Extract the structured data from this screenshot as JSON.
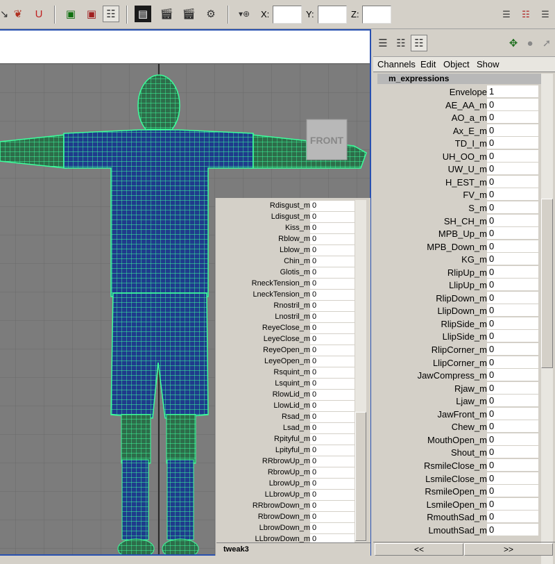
{
  "toolbar": {
    "icons": [
      "snap-arrow-icon",
      "snap-curve-icon",
      "snap-magnet-icon",
      "render-region-icon",
      "render-camera-icon",
      "render-settings-icon",
      "clapper-icon",
      "clapper-ipr-icon",
      "clapper-hw-icon",
      "clapper-settings-icon",
      "select-marker-icon"
    ],
    "x_label": "X:",
    "y_label": "Y:",
    "z_label": "Z:",
    "x_value": "",
    "y_value": "",
    "z_value": ""
  },
  "viewport": {
    "view_cube_label": "FRONT",
    "mesh_color": "#3cff9c",
    "background_color": "#7c7c7c"
  },
  "tweak_panel": {
    "node": "tweak3",
    "channels": [
      {
        "name": "Rdisgust_m",
        "value": "0"
      },
      {
        "name": "Ldisgust_m",
        "value": "0"
      },
      {
        "name": "Kiss_m",
        "value": "0"
      },
      {
        "name": "Rblow_m",
        "value": "0"
      },
      {
        "name": "Lblow_m",
        "value": "0"
      },
      {
        "name": "Chin_m",
        "value": "0"
      },
      {
        "name": "Glotis_m",
        "value": "0"
      },
      {
        "name": "RneckTension_m",
        "value": "0"
      },
      {
        "name": "LneckTension_m",
        "value": "0"
      },
      {
        "name": "Rnostril_m",
        "value": "0"
      },
      {
        "name": "Lnostril_m",
        "value": "0"
      },
      {
        "name": "ReyeClose_m",
        "value": "0"
      },
      {
        "name": "LeyeClose_m",
        "value": "0"
      },
      {
        "name": "ReyeOpen_m",
        "value": "0"
      },
      {
        "name": "LeyeOpen_m",
        "value": "0"
      },
      {
        "name": "Rsquint_m",
        "value": "0"
      },
      {
        "name": "Lsquint_m",
        "value": "0"
      },
      {
        "name": "RlowLid_m",
        "value": "0"
      },
      {
        "name": "LlowLid_m",
        "value": "0"
      },
      {
        "name": "Rsad_m",
        "value": "0"
      },
      {
        "name": "Lsad_m",
        "value": "0"
      },
      {
        "name": "Rpityful_m",
        "value": "0"
      },
      {
        "name": "Lpityful_m",
        "value": "0"
      },
      {
        "name": "RRbrowUp_m",
        "value": "0"
      },
      {
        "name": "RbrowUp_m",
        "value": "0"
      },
      {
        "name": "LbrowUp_m",
        "value": "0"
      },
      {
        "name": "LLbrowUp_m",
        "value": "0"
      },
      {
        "name": "RRbrowDown_m",
        "value": "0"
      },
      {
        "name": "RbrowDown_m",
        "value": "0"
      },
      {
        "name": "LbrowDown_m",
        "value": "0"
      },
      {
        "name": "LLbrowDown_m",
        "value": "0"
      }
    ]
  },
  "channel_box": {
    "menu": [
      "Channels",
      "Edit",
      "Object",
      "Show"
    ],
    "node": "m_expressions",
    "channels": [
      {
        "name": "Envelope",
        "value": "1"
      },
      {
        "name": "AE_AA_m",
        "value": "0"
      },
      {
        "name": "AO_a_m",
        "value": "0"
      },
      {
        "name": "Ax_E_m",
        "value": "0"
      },
      {
        "name": "TD_I_m",
        "value": "0"
      },
      {
        "name": "UH_OO_m",
        "value": "0"
      },
      {
        "name": "UW_U_m",
        "value": "0"
      },
      {
        "name": "H_EST_m",
        "value": "0"
      },
      {
        "name": "FV_m",
        "value": "0"
      },
      {
        "name": "S_m",
        "value": "0"
      },
      {
        "name": "SH_CH_m",
        "value": "0"
      },
      {
        "name": "MPB_Up_m",
        "value": "0"
      },
      {
        "name": "MPB_Down_m",
        "value": "0"
      },
      {
        "name": "KG_m",
        "value": "0"
      },
      {
        "name": "RlipUp_m",
        "value": "0"
      },
      {
        "name": "LlipUp_m",
        "value": "0"
      },
      {
        "name": "RlipDown_m",
        "value": "0"
      },
      {
        "name": "LlipDown_m",
        "value": "0"
      },
      {
        "name": "RlipSide_m",
        "value": "0"
      },
      {
        "name": "LlipSide_m",
        "value": "0"
      },
      {
        "name": "RlipCorner_m",
        "value": "0"
      },
      {
        "name": "LlipCorner_m",
        "value": "0"
      },
      {
        "name": "JawCompress_m",
        "value": "0"
      },
      {
        "name": "Rjaw_m",
        "value": "0"
      },
      {
        "name": "Ljaw_m",
        "value": "0"
      },
      {
        "name": "JawFront_m",
        "value": "0"
      },
      {
        "name": "Chew_m",
        "value": "0"
      },
      {
        "name": "MouthOpen_m",
        "value": "0"
      },
      {
        "name": "Shout_m",
        "value": "0"
      },
      {
        "name": "RsmileClose_m",
        "value": "0"
      },
      {
        "name": "LsmileClose_m",
        "value": "0"
      },
      {
        "name": "RsmileOpen_m",
        "value": "0"
      },
      {
        "name": "LsmileOpen_m",
        "value": "0"
      },
      {
        "name": "RmouthSad_m",
        "value": "0"
      },
      {
        "name": "LmouthSad_m",
        "value": "0"
      }
    ],
    "nav_prev": "<<",
    "nav_next": ">>"
  }
}
